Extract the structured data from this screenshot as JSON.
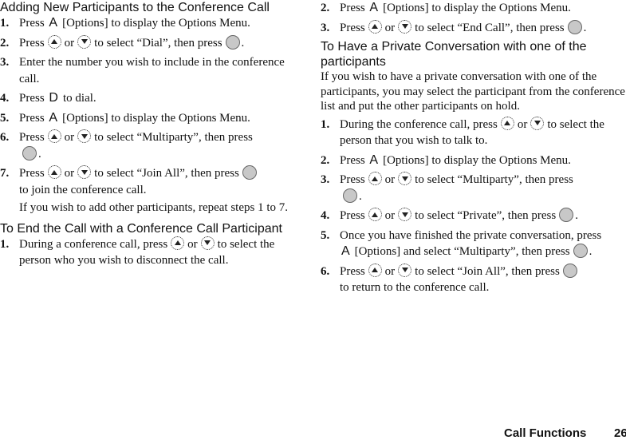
{
  "left": {
    "heading1": "Adding New Participants to the Conference Call",
    "steps1": [
      {
        "num": "1.",
        "a": "Press ",
        "key": "A",
        "b": "[Options] to display the Options Menu."
      },
      {
        "num": "2.",
        "a": "Press",
        "or": "or",
        "b": "to select “Dial”, then press",
        "c": "."
      },
      {
        "num": "3.",
        "text": "Enter the number you wish to include in the conference call."
      },
      {
        "num": "4.",
        "a": "Press ",
        "key": "D",
        "b": "to dial."
      },
      {
        "num": "5.",
        "a": "Press ",
        "key": "A",
        "b": "[Options] to display the Options Menu."
      },
      {
        "num": "6.",
        "a": "Press",
        "or": "or",
        "b": "to select “Multiparty”, then press",
        "c": "."
      },
      {
        "num": "7.",
        "a": "Press",
        "or": "or",
        "b": "to select “Join All”, then press",
        "c": "to join the conference call."
      }
    ],
    "note": "If you wish to add other participants, repeat steps 1 to 7.",
    "heading2": "To End the Call with a Conference Call Participant",
    "steps2": [
      {
        "num": "1.",
        "a": "During a conference call, press",
        "or": "or",
        "b": "to select the person who you wish to disconnect the call."
      }
    ]
  },
  "right": {
    "steps0": [
      {
        "num": "2.",
        "a": "Press ",
        "key": "A",
        "b": "[Options] to display the Options Menu."
      },
      {
        "num": "3.",
        "a": "Press",
        "or": "or",
        "b": "to select “End Call”, then press",
        "c": "."
      }
    ],
    "heading": "To Have a Private Conversation with one of the participants",
    "intro": "If you wish to have a private conversation with one of the participants, you may select the participant from the conference list and put the other participants on hold.",
    "steps": [
      {
        "num": "1.",
        "a": "During the conference call, press",
        "or": "or",
        "b": "to select the person that you wish to talk to."
      },
      {
        "num": "2.",
        "a": "Press ",
        "key": "A",
        "b": "[Options] to display the Options Menu."
      },
      {
        "num": "3.",
        "a": "Press",
        "or": "or",
        "b": "to select “Multiparty”, then press",
        "c": "."
      },
      {
        "num": "4.",
        "a": "Press",
        "or": "or",
        "b": "to select “Private”, then press",
        "c": "."
      },
      {
        "num": "5.",
        "a": "Once you have finished the private conversation, press ",
        "key": "A",
        "b": "[Options] and select “Multiparty”, then press",
        "c": "."
      },
      {
        "num": "6.",
        "a": "Press",
        "or": "or",
        "b": "to select “Join All”, then press",
        "c": "to return to the conference call."
      }
    ]
  },
  "footer": {
    "section": "Call Functions",
    "page": "26"
  },
  "icons": {
    "up": "nav-up-icon",
    "down": "nav-down-icon",
    "ok": "center-key-icon"
  }
}
